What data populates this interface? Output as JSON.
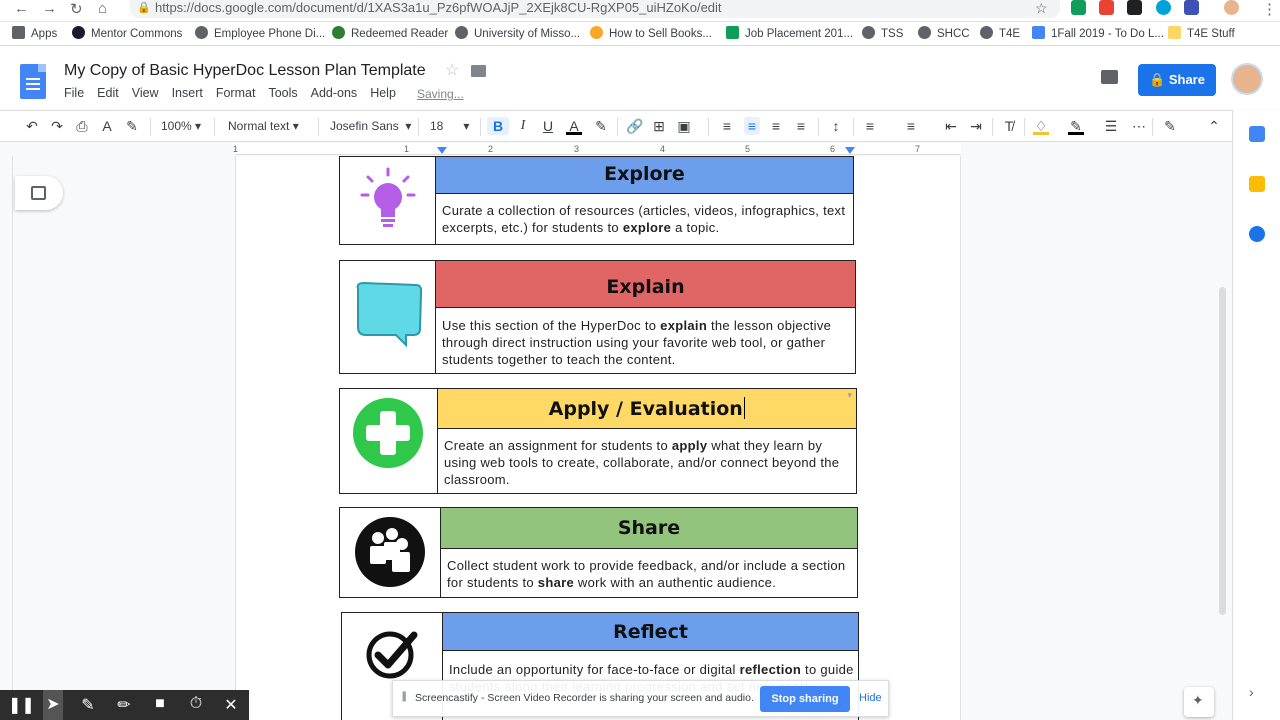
{
  "browser": {
    "url": "https://docs.google.com/document/d/1XAS3a1u_Pz6pfWOAJjP_2XEjk8CU-RgXP05_uiHZoKo/edit",
    "bookmarks": [
      {
        "label": "Apps",
        "color": "#5f6368"
      },
      {
        "label": "Mentor Commons",
        "color": "#1a1a2e"
      },
      {
        "label": "Employee Phone Di...",
        "color": "#5f6368"
      },
      {
        "label": "Redeemed Reader",
        "color": "#2e7d32"
      },
      {
        "label": "University of Misso...",
        "color": "#5f6368"
      },
      {
        "label": "How to Sell Books...",
        "color": "#f9a825"
      },
      {
        "label": "Job Placement 201...",
        "color": "#0f9d58"
      },
      {
        "label": "TSS",
        "color": "#5f6368"
      },
      {
        "label": "SHCC",
        "color": "#5f6368"
      },
      {
        "label": "T4E",
        "color": "#5f6368"
      },
      {
        "label": "1Fall 2019 - To Do L...",
        "color": "#4285f4"
      },
      {
        "label": "T4E Stuff",
        "color": "#fdd663"
      }
    ]
  },
  "doc": {
    "title": "My Copy of Basic HyperDoc Lesson Plan Template",
    "menus": [
      "File",
      "Edit",
      "View",
      "Insert",
      "Format",
      "Tools",
      "Add-ons",
      "Help"
    ],
    "status": "Saving...",
    "share_label": "Share"
  },
  "toolbar": {
    "zoom": "100%",
    "style": "Normal text",
    "font": "Josefin Sans",
    "size": "18",
    "bold": "B",
    "italic": "I",
    "underline": "U",
    "text_color": "A"
  },
  "ruler_numbers": [
    "1",
    "1",
    "2",
    "3",
    "4",
    "5",
    "6",
    "7"
  ],
  "rows": [
    {
      "title": "Explore",
      "color": "#6d9eeb",
      "text_parts": [
        "Curate a collection of resources (articles, videos, infographics, text excerpts, etc.) for students to ",
        "explore",
        " a topic."
      ],
      "icon": "lightbulb-icon"
    },
    {
      "title": "Explain",
      "color": "#e06666",
      "text_parts": [
        "Use this section of the HyperDoc to ",
        "explain",
        " the lesson objective through direct instruction using your favorite web tool, or gather students together to teach the content."
      ],
      "icon": "speech-bubble-icon"
    },
    {
      "title": "Apply / Evaluation",
      "color": "#ffd966",
      "text_parts": [
        "Create an assignment for students to ",
        "apply",
        " what they learn by using web tools to create, collaborate, and/or connect beyond the classroom."
      ],
      "icon": "plus-icon"
    },
    {
      "title": "Share",
      "color": "#93c47d",
      "text_parts": [
        "Collect student work to provide feedback, and/or include a section for students to ",
        "share",
        " work with an authentic audience."
      ],
      "icon": "people-icon"
    },
    {
      "title": "Reflect",
      "color": "#6d9eeb",
      "text_parts": [
        "Include an opportunity for face-to-face or digital ",
        "reflection",
        " to guide students along their learning progression and set new goals."
      ],
      "icon": "checkmark-icon"
    }
  ],
  "recorder": {
    "message": "Screencastify - Screen Video Recorder is sharing your screen and audio.",
    "stop_label": "Stop sharing",
    "hide_label": "Hide"
  }
}
